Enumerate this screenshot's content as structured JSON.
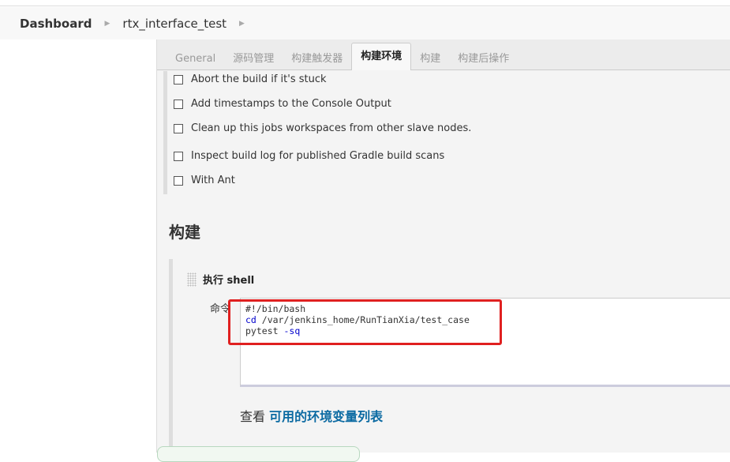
{
  "breadcrumb": {
    "items": [
      "Dashboard",
      "rtx_interface_test"
    ]
  },
  "tabs": [
    {
      "label": "General"
    },
    {
      "label": "源码管理"
    },
    {
      "label": "构建触发器"
    },
    {
      "label": "构建环境",
      "active": true
    },
    {
      "label": "构建"
    },
    {
      "label": "构建后操作"
    }
  ],
  "options": [
    "Abort the build if it's stuck",
    "Add timestamps to the Console Output",
    "Clean up this jobs workspaces from other slave nodes.",
    "Inspect build log for published Gradle build scans",
    "With Ant"
  ],
  "build": {
    "heading": "构建",
    "step_title": "执行 shell",
    "command_label": "命令",
    "command_lines": [
      {
        "kw": "",
        "rest": "#!/bin/bash"
      },
      {
        "kw": "cd",
        "rest": " /var/jenkins_home/RunTianXia/test_case"
      },
      {
        "kw": "",
        "rest": "pytest ",
        "kw2": "-sq"
      }
    ],
    "env_prefix": "查看 ",
    "env_link": "可用的环境变量列表"
  },
  "colors": {
    "highlight": "#e02020",
    "link": "#0b6aa2"
  }
}
